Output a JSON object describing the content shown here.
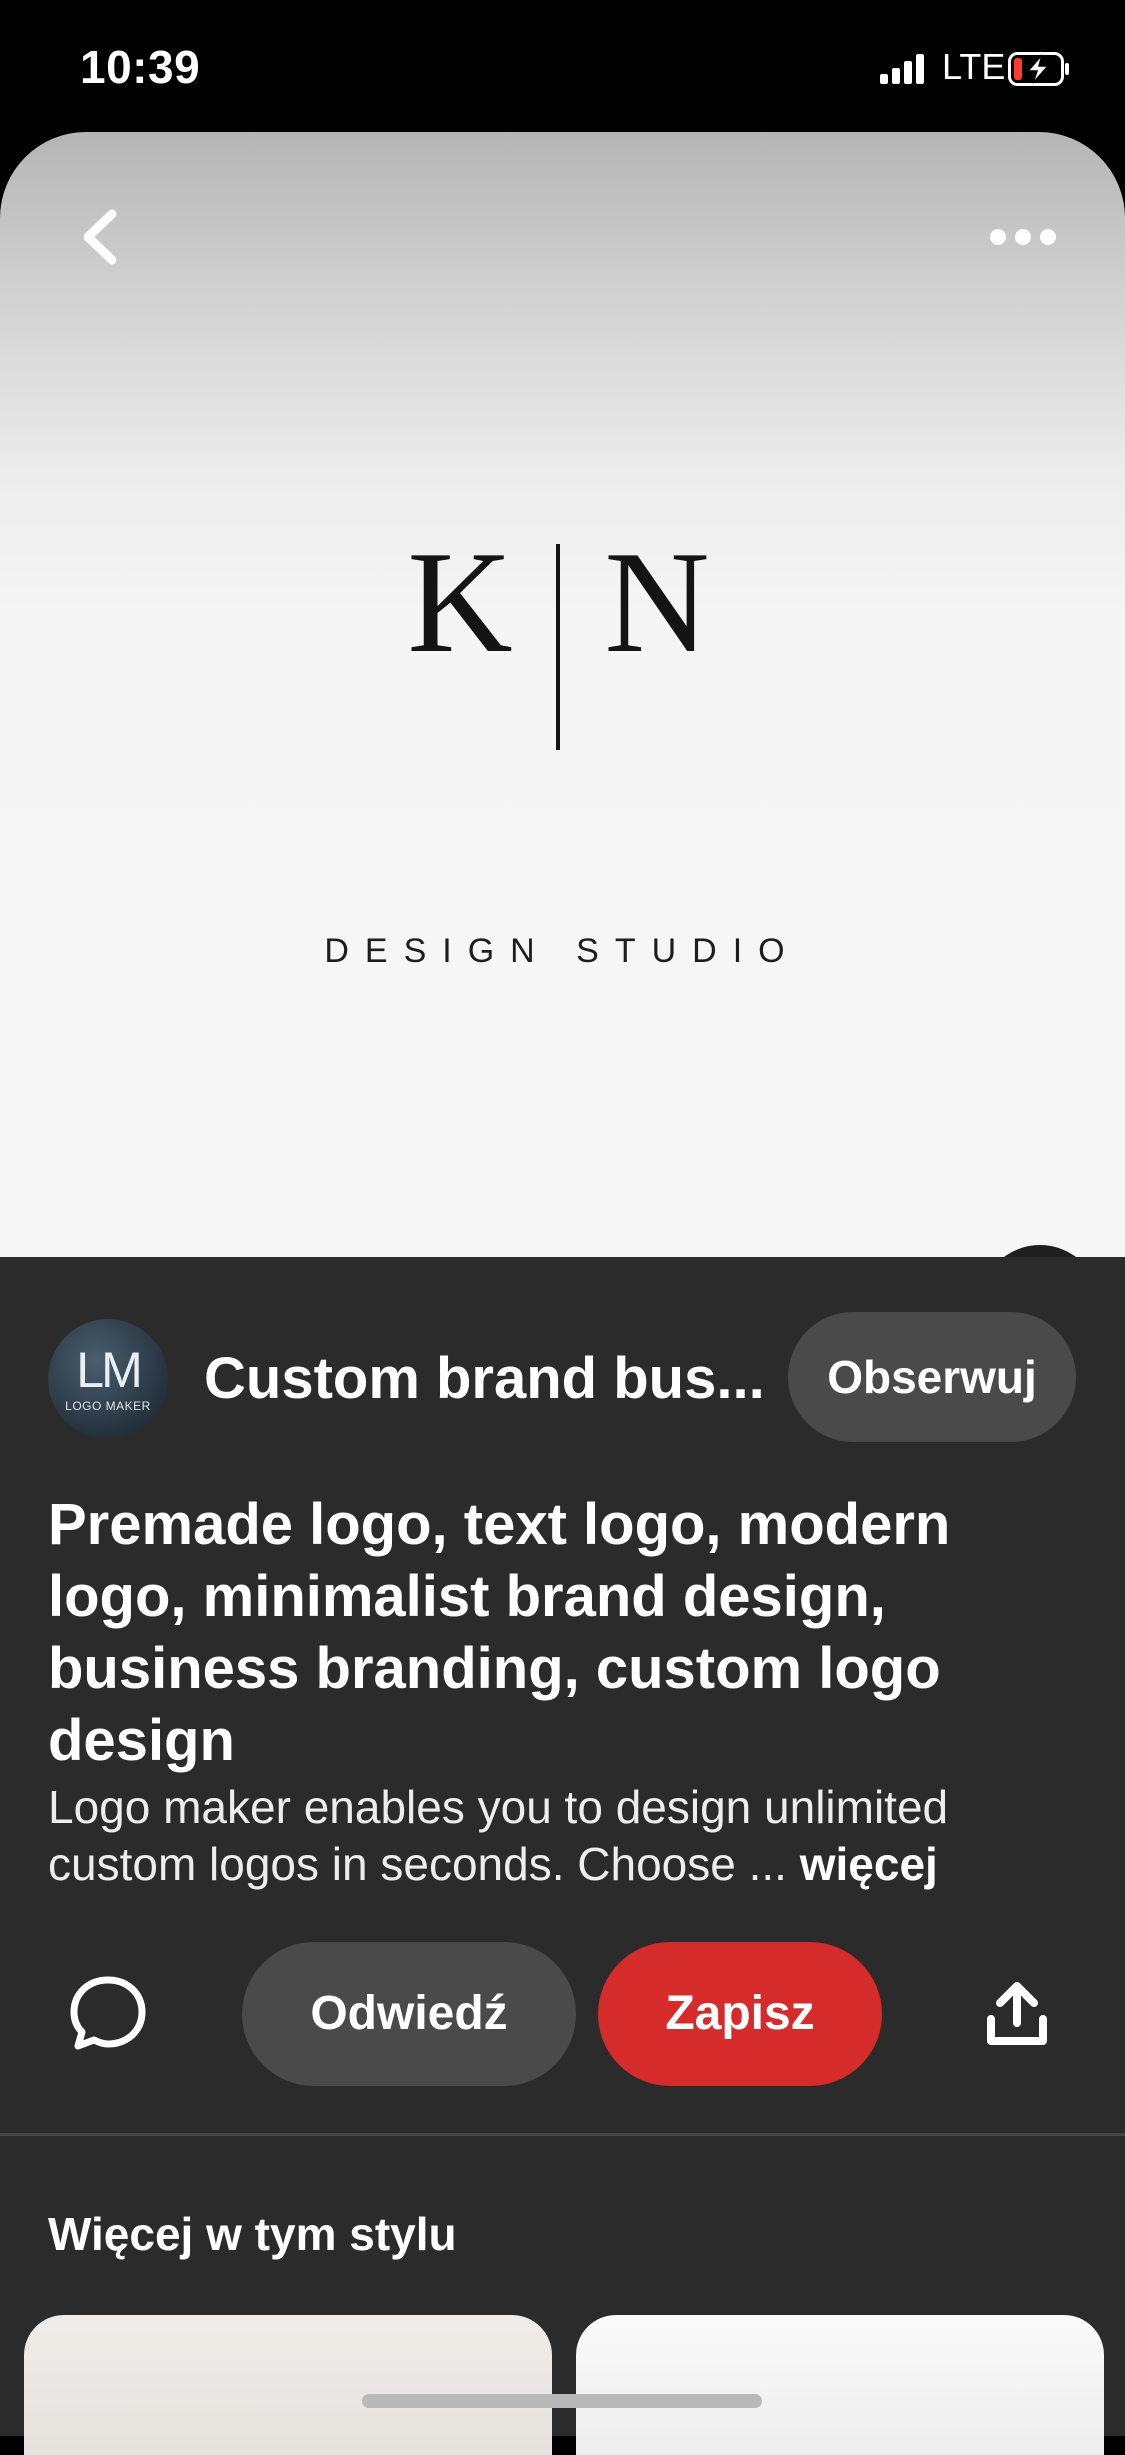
{
  "status_bar": {
    "time": "10:39",
    "network": "LTE",
    "icons": [
      "signal-icon",
      "battery-charging-icon"
    ]
  },
  "pin_image": {
    "logo_left_letter": "K",
    "logo_right_letter": "N",
    "logo_tagline": "DESIGN STUDIO",
    "icons": [
      "back-arrow-icon",
      "more-options-icon",
      "visual-search-icon"
    ]
  },
  "creator": {
    "avatar_monogram": "LM",
    "avatar_caption": "LOGO MAKER",
    "board_title": "Custom brand bus...",
    "follow_label": "Obserwuj"
  },
  "pin": {
    "title": "Premade logo, text logo, modern logo, minimalist brand design, business branding, custom logo design",
    "description": "Logo maker enables you to design unlimited custom logos in seconds. Choose ...",
    "more_label": "więcej"
  },
  "actions": {
    "visit_label": "Odwiedź",
    "save_label": "Zapisz",
    "icons": [
      "comment-icon",
      "share-icon"
    ]
  },
  "more_section": {
    "title": "Więcej w tym stylu"
  },
  "colors": {
    "background": "#2b2b2b",
    "save_button": "#d62b2b",
    "secondary_button": "#4a4a4a",
    "battery_low": "#ff3b30"
  }
}
